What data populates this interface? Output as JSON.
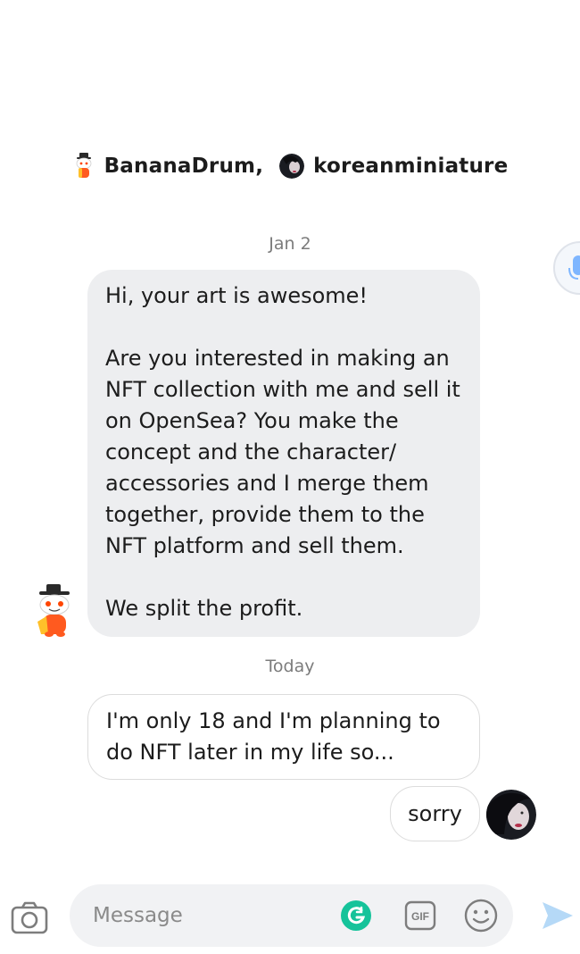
{
  "header": {
    "participants": [
      {
        "name": "BananaDrum,",
        "avatar": "snoo-avatar"
      },
      {
        "name": "koreanminiature",
        "avatar": "photo-avatar"
      }
    ]
  },
  "voice_button": {
    "icon": "microphone-icon"
  },
  "messages": {
    "date1": "Jan 2",
    "msg1": "Hi, your art is awesome!\n\nAre you interested in making an NFT collection with me and sell it on OpenSea? You make the concept and the character/ accessories and I merge them together, provide them to the NFT platform and sell them.\n\nWe split the profit.",
    "date2": "Today",
    "msg2": "I'm only 18 and I'm planning to do NFT later in my life so...",
    "msg3": "sorry"
  },
  "composer": {
    "placeholder": "Message",
    "gif_label": "GIF",
    "icons": [
      "camera-icon",
      "grammarly-icon",
      "gif-icon",
      "emoji-icon",
      "send-icon"
    ]
  },
  "colors": {
    "bubble_gray": "#edeef0",
    "bubble_border": "#dcdcdc",
    "grammarly_green": "#15c39a",
    "send_blue": "#b5d9f7",
    "text": "#1c1c1c",
    "muted": "#7c7c7c"
  }
}
